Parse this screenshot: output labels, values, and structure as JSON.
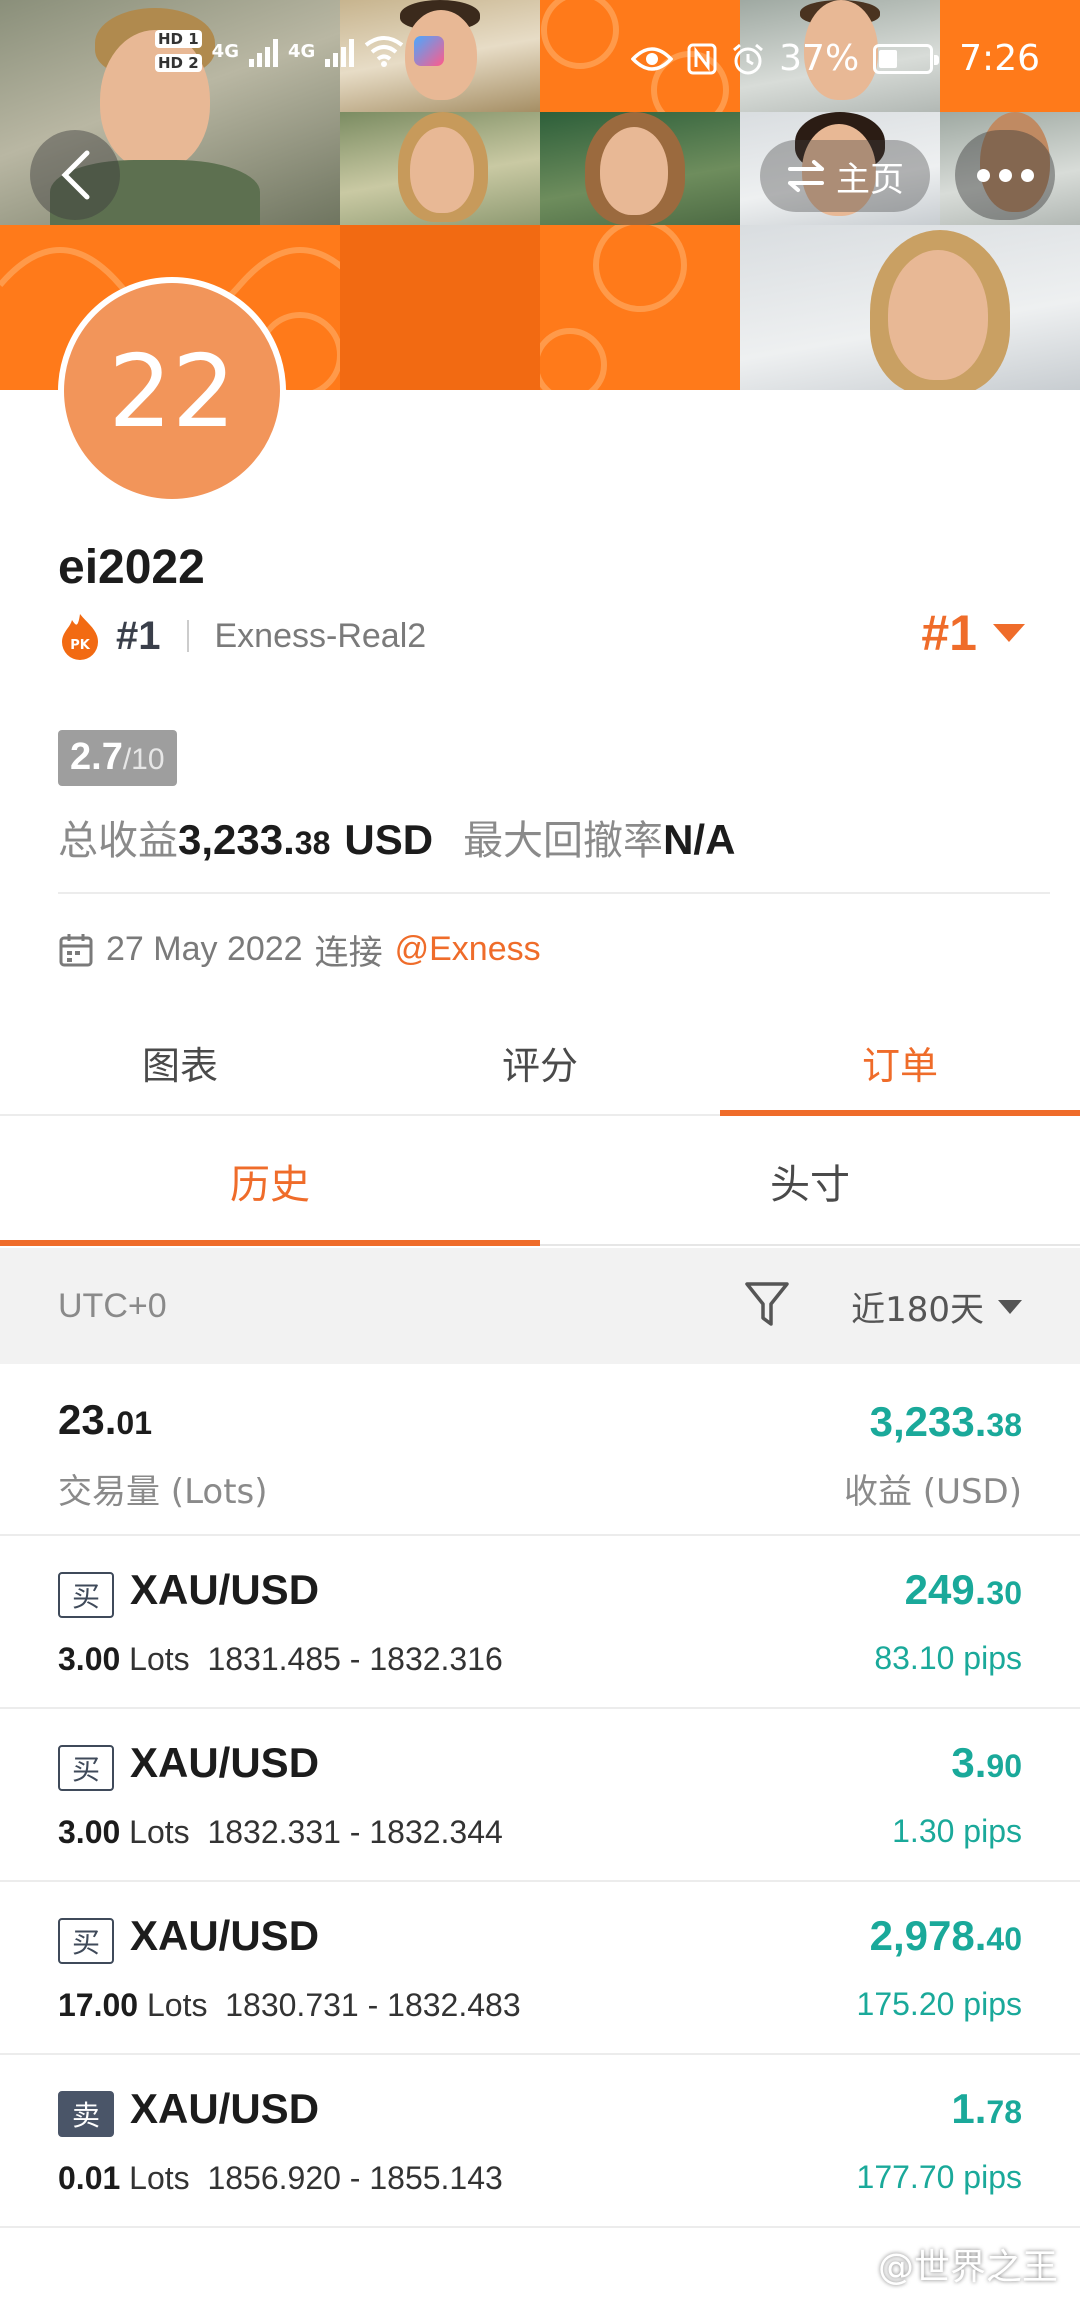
{
  "status_bar": {
    "hd1": "HD 1",
    "hd2": "HD 2",
    "net1": "4G",
    "net2": "4G",
    "battery_pct": "37%",
    "battery_level": 0.37,
    "time": "7:26"
  },
  "nav": {
    "home_label": "主页"
  },
  "profile": {
    "avatar_text": "22",
    "username": "ei2022",
    "pk_label": "PK",
    "rank_small": "#1",
    "server": "Exness-Real2",
    "rank_big": "#1",
    "score": "2.7",
    "score_max": "/10",
    "total_profit_label": "总收益",
    "total_profit_int": "3,233.",
    "total_profit_cents": "38",
    "total_profit_unit": "USD",
    "drawdown_label": "最大回撤率",
    "drawdown_value": "N/A",
    "connected_date": "27 May 2022",
    "connected_label": "连接",
    "broker_link": "@Exness"
  },
  "tabs": {
    "chart": "图表",
    "rating": "评分",
    "orders": "订单"
  },
  "subtabs": {
    "history": "历史",
    "positions": "头寸"
  },
  "filter": {
    "timezone": "UTC+0",
    "range": "近180天"
  },
  "summary": {
    "lots_int": "23.",
    "lots_dec": "01",
    "lots_label": "交易量 (Lots)",
    "profit_int": "3,233.",
    "profit_dec": "38",
    "profit_label": "收益 (USD)"
  },
  "orders": [
    {
      "side": "买",
      "symbol": "XAU/USD",
      "lots": "3.00",
      "lots_unit": "Lots",
      "range": "1831.485 - 1832.316",
      "profit_int": "249.",
      "profit_dec": "30",
      "pips": "83.10 pips"
    },
    {
      "side": "买",
      "symbol": "XAU/USD",
      "lots": "3.00",
      "lots_unit": "Lots",
      "range": "1832.331 - 1832.344",
      "profit_int": "3.",
      "profit_dec": "90",
      "pips": "1.30 pips"
    },
    {
      "side": "买",
      "symbol": "XAU/USD",
      "lots": "17.00",
      "lots_unit": "Lots",
      "range": "1830.731 - 1832.483",
      "profit_int": "2,978.",
      "profit_dec": "40",
      "pips": "175.20 pips"
    },
    {
      "side": "卖",
      "symbol": "XAU/USD",
      "lots": "0.01",
      "lots_unit": "Lots",
      "range": "1856.920 - 1855.143",
      "profit_int": "1.",
      "profit_dec": "78",
      "pips": "177.70 pips"
    }
  ],
  "watermark": "@世界之王",
  "colors": {
    "accent": "#ef6c2a",
    "profit": "#1aa99a",
    "banner_orange": "#ff7a1a"
  }
}
